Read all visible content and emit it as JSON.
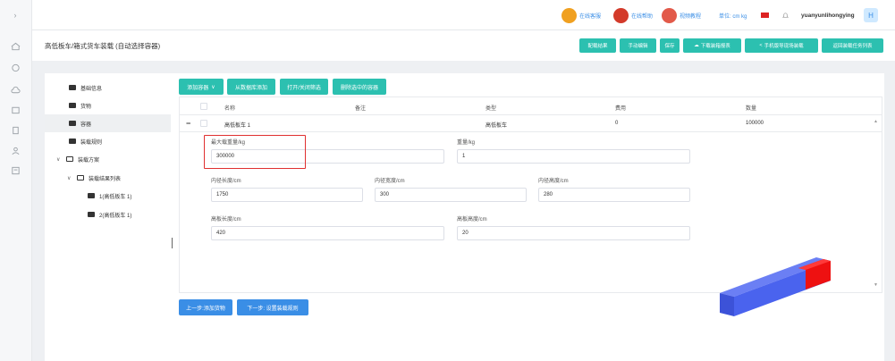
{
  "topbar": {
    "online_service": "在线客服",
    "online_help": "在线帮助",
    "video_tutorial": "视频教程",
    "unit": "单位: cm kg",
    "username": "yuanyunlihongying",
    "avatar_letter": "H"
  },
  "page": {
    "title": "高低板车/箱式货车装载 (自动选择容器)",
    "buttons": [
      "配载结果",
      "手动编辑",
      "保存",
      "下载装箱报表",
      "手机版导现场装载",
      "返回装载任务列表"
    ]
  },
  "tree": {
    "items": [
      {
        "label": "基础信息"
      },
      {
        "label": "货物"
      },
      {
        "label": "容器"
      },
      {
        "label": "装载规则"
      },
      {
        "label": "装载方案"
      },
      {
        "label": "装载结果列表"
      },
      {
        "label": "1(高低板车 1)"
      },
      {
        "label": "2(高低板车 1)"
      }
    ]
  },
  "toolbar": {
    "add_container": "添加容器",
    "add_from_db": "从数据库添加",
    "toggle_filter": "打开/关闭筛选",
    "delete_selected": "删除选中的容器"
  },
  "table": {
    "headers": [
      "名称",
      "备注",
      "类型",
      "费用",
      "数量"
    ],
    "row": {
      "name": "高低板车 1",
      "note": "",
      "type": "高低板车",
      "cost": "0",
      "qty": "100000"
    }
  },
  "form": {
    "max_load_label": "最大载重量/kg",
    "max_load_value": "300000",
    "weight_label": "重量/kg",
    "weight_value": "1",
    "inner_length_label": "内径长度/cm",
    "inner_length_value": "1750",
    "inner_width_label": "内径宽度/cm",
    "inner_width_value": "300",
    "inner_height_label": "内径高度/cm",
    "inner_height_value": "280",
    "high_length_label": "高板长度/cm",
    "high_length_value": "420",
    "high_height_label": "高板高度/cm",
    "high_height_value": "20"
  },
  "footer": {
    "prev": "上一步:添加货物",
    "next": "下一步: 设置装载规则"
  },
  "colors": {
    "teal": "#2cc0b0",
    "blue": "#3a8ee6",
    "highlight": "#e03030",
    "box_blue": "#4a63ee",
    "box_red": "#ee1111"
  }
}
